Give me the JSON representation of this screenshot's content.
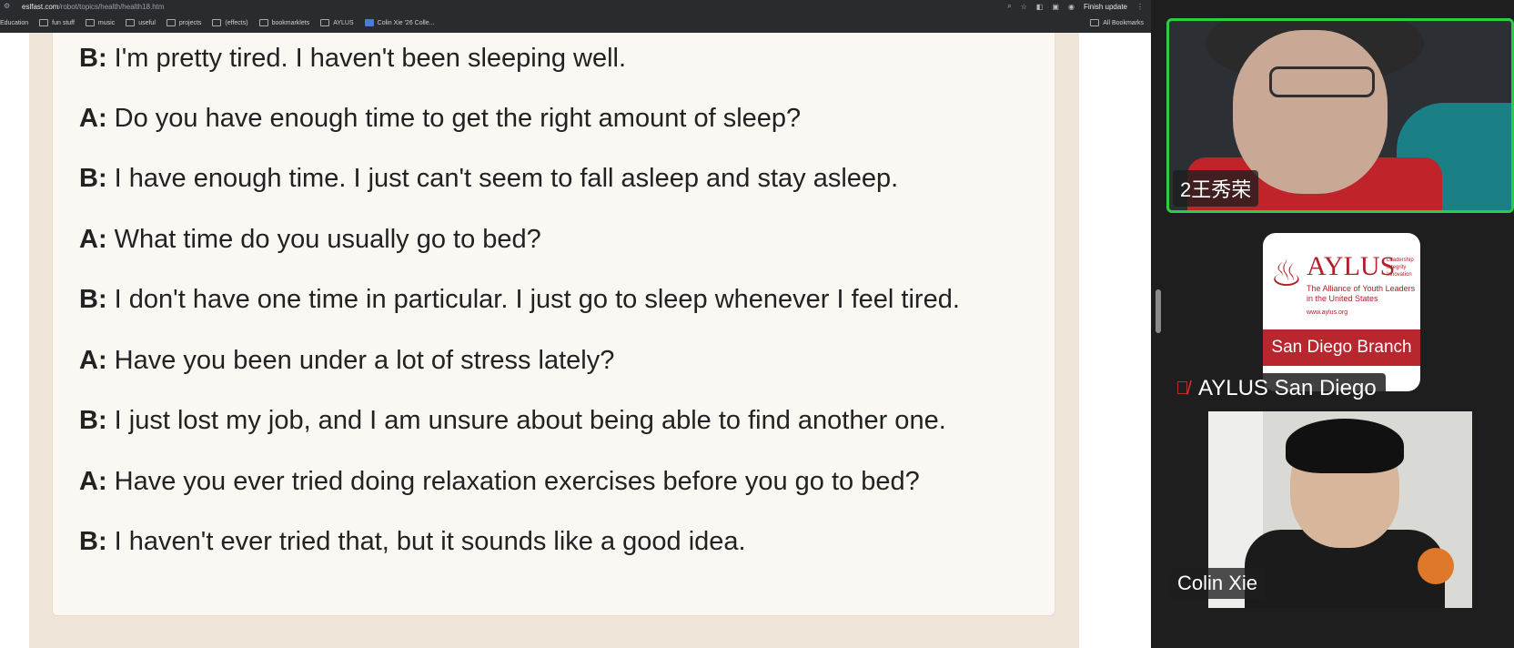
{
  "browser": {
    "url_domain": "eslfast.com",
    "url_path": "/robot/topics/health/health18.htm",
    "finish_update": "Finish update",
    "bookmarks": [
      "Education",
      "fun stuff",
      "music",
      "useful",
      "projects",
      "(effects)",
      "bookmarklets",
      "AYLUS",
      "Colin Xie '26 Colle..."
    ],
    "all_bookmarks": "All Bookmarks"
  },
  "dialogue": [
    {
      "speaker": "B:",
      "text": "I'm pretty tired. I haven't been sleeping well."
    },
    {
      "speaker": "A:",
      "text": "Do you have enough time to get the right amount of sleep?"
    },
    {
      "speaker": "B:",
      "text": "I have enough time. I just can't seem to fall asleep and stay asleep."
    },
    {
      "speaker": "A:",
      "text": "What time do you usually go to bed?"
    },
    {
      "speaker": "B:",
      "text": "I don't have one time in particular. I just go to sleep whenever I feel tired."
    },
    {
      "speaker": "A:",
      "text": "Have you been under a lot of stress lately?"
    },
    {
      "speaker": "B:",
      "text": "I just lost my job, and I am unsure about being able to find another one."
    },
    {
      "speaker": "A:",
      "text": "Have you ever tried doing relaxation exercises before you go to bed?"
    },
    {
      "speaker": "B:",
      "text": "I haven't ever tried that, but it sounds like a good idea."
    }
  ],
  "participants": {
    "p1_name": "2王秀荣",
    "p2_name": "AYLUS San Diego",
    "p3_name": "Colin Xie"
  },
  "aylus_logo": {
    "title": "AYLUS",
    "tagline": "Leadership Integrity Innovation",
    "desc": "The Alliance of Youth Leaders in the United States",
    "url": "www.aylus.org",
    "branch": "San Diego Branch"
  },
  "colors": {
    "active_speaker_border": "#2ecc40",
    "card_background": "#fbf7f3",
    "outer_background": "#efe4d8",
    "aylus_red": "#b8262e"
  }
}
